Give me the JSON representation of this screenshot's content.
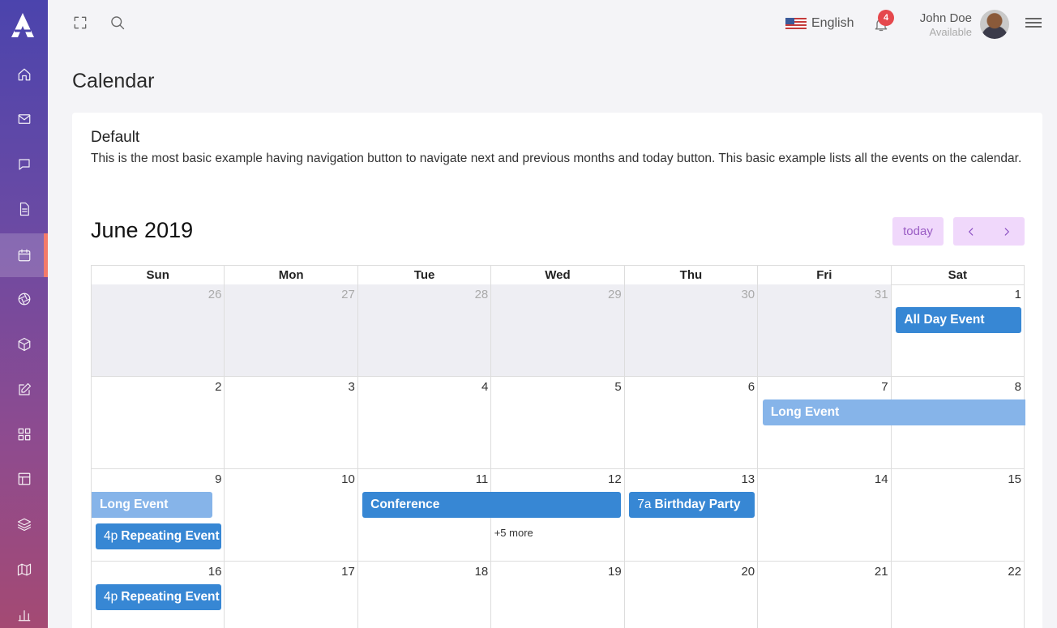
{
  "sidebar": {
    "logo": "app-logo",
    "items": [
      {
        "name": "home",
        "icon": "home-icon"
      },
      {
        "name": "mail",
        "icon": "mail-icon"
      },
      {
        "name": "chat",
        "icon": "chat-icon"
      },
      {
        "name": "documents",
        "icon": "document-icon"
      },
      {
        "name": "calendar",
        "icon": "calendar-icon",
        "active": true
      },
      {
        "name": "aperture",
        "icon": "aperture-icon"
      },
      {
        "name": "box",
        "icon": "box-icon"
      },
      {
        "name": "edit",
        "icon": "edit-icon"
      },
      {
        "name": "grid",
        "icon": "grid-icon"
      },
      {
        "name": "layout",
        "icon": "layout-icon"
      },
      {
        "name": "layers",
        "icon": "layers-icon"
      },
      {
        "name": "map",
        "icon": "map-icon"
      },
      {
        "name": "charts",
        "icon": "bar-chart-icon"
      }
    ],
    "active_color": "#f37a6a"
  },
  "topbar": {
    "language": "English",
    "notifications_count": "4",
    "user_name": "John Doe",
    "user_status": "Available"
  },
  "page_title": "Calendar",
  "card": {
    "title": "Default",
    "description": "This is the most basic example having navigation button to navigate next and previous months and today button. This basic example lists all the events on the calendar."
  },
  "calendar": {
    "month_title": "June 2019",
    "today_label": "today",
    "weekdays": [
      "Sun",
      "Mon",
      "Tue",
      "Wed",
      "Thu",
      "Fri",
      "Sat"
    ],
    "weeks": [
      [
        "26",
        "27",
        "28",
        "29",
        "30",
        "31",
        "1"
      ],
      [
        "2",
        "3",
        "4",
        "5",
        "6",
        "7",
        "8"
      ],
      [
        "9",
        "10",
        "11",
        "12",
        "13",
        "14",
        "15"
      ],
      [
        "16",
        "17",
        "18",
        "19",
        "20",
        "21",
        "22"
      ]
    ],
    "other_month_week0": [
      true,
      true,
      true,
      true,
      true,
      true,
      false
    ],
    "events": [
      {
        "title": "All Day Event",
        "time": "",
        "week": 0,
        "start": 6,
        "span": 1,
        "row": 0,
        "style": "dark"
      },
      {
        "title": "Long Event",
        "time": "",
        "week": 1,
        "start": 5,
        "span": 2,
        "row": 0,
        "style": "light",
        "continues": true
      },
      {
        "title": "Long Event",
        "time": "",
        "week": 2,
        "start": 0,
        "span": 1,
        "row": 0,
        "style": "light",
        "starts_before": true
      },
      {
        "title": "Repeating Event",
        "time": "4p",
        "week": 2,
        "start": 0,
        "span": 1,
        "row": 1,
        "style": "dark"
      },
      {
        "title": "Conference",
        "time": "",
        "week": 2,
        "start": 2,
        "span": 2,
        "row": 0,
        "style": "dark"
      },
      {
        "title": "Birthday Party",
        "time": "7a",
        "week": 2,
        "start": 4,
        "span": 1,
        "row": 0,
        "style": "dark"
      },
      {
        "title": "Repeating Event",
        "time": "4p",
        "week": 3,
        "start": 0,
        "span": 1,
        "row": 0,
        "style": "dark"
      }
    ],
    "more_link": {
      "label": "+5 more",
      "week": 2,
      "day": 3
    },
    "event_color": "#3787d4",
    "event_light_color": "#86b4e9",
    "button_bg": "#f0d8fb"
  }
}
